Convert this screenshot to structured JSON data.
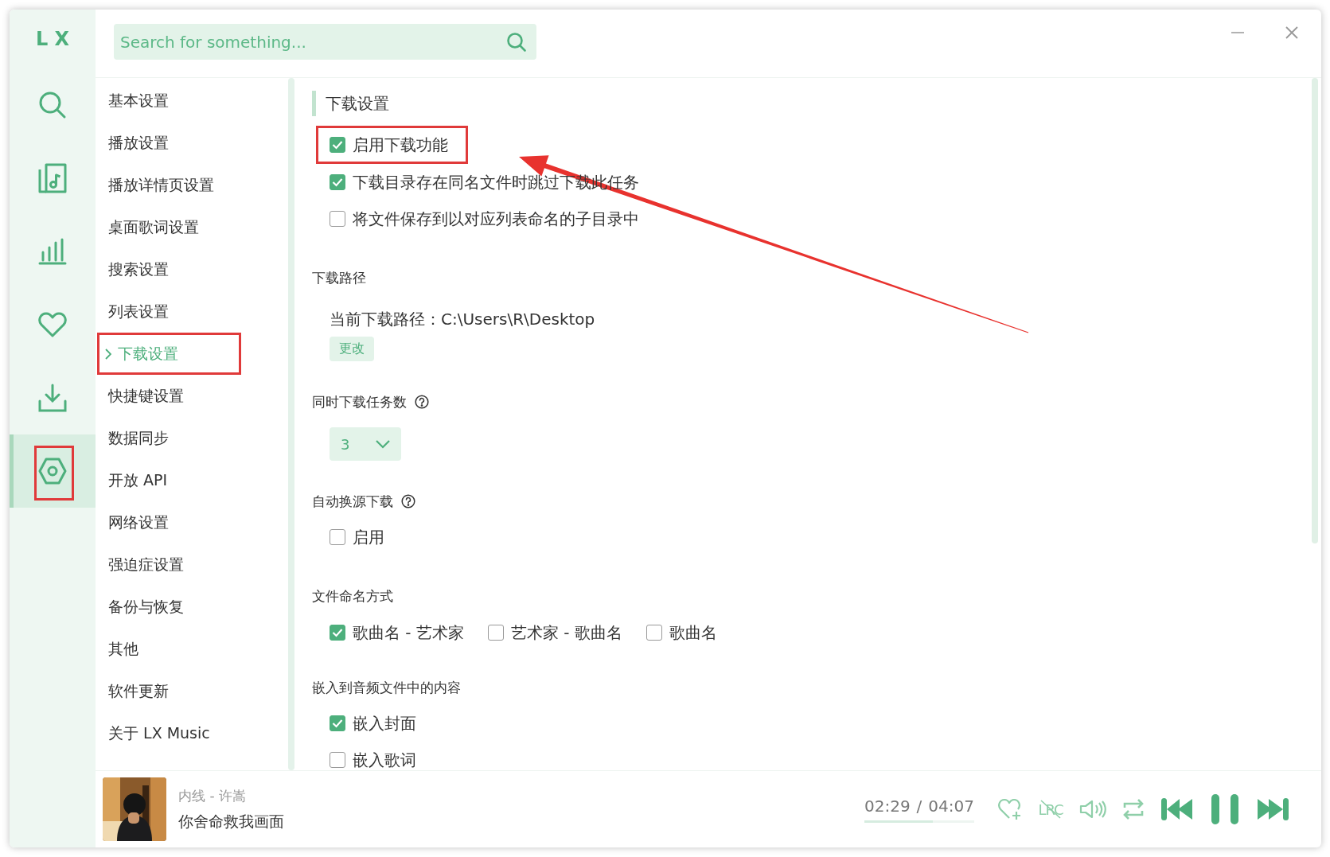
{
  "logo": "L X",
  "rail": [
    {
      "selected": false,
      "annotated": false
    },
    {
      "selected": false,
      "annotated": false
    },
    {
      "selected": false,
      "annotated": false
    },
    {
      "selected": false,
      "annotated": false
    },
    {
      "selected": false,
      "annotated": false
    },
    {
      "selected": true,
      "annotated": true
    }
  ],
  "search": {
    "placeholder": "Search for something..."
  },
  "settings_nav": [
    {
      "label": "基本设置",
      "selected": false,
      "annotated": false
    },
    {
      "label": "播放设置",
      "selected": false,
      "annotated": false
    },
    {
      "label": "播放详情页设置",
      "selected": false,
      "annotated": false
    },
    {
      "label": "桌面歌词设置",
      "selected": false,
      "annotated": false
    },
    {
      "label": "搜索设置",
      "selected": false,
      "annotated": false
    },
    {
      "label": "列表设置",
      "selected": false,
      "annotated": false
    },
    {
      "label": "下载设置",
      "selected": true,
      "annotated": true
    },
    {
      "label": "快捷键设置",
      "selected": false,
      "annotated": false
    },
    {
      "label": "数据同步",
      "selected": false,
      "annotated": false
    },
    {
      "label": "开放 API",
      "selected": false,
      "annotated": false
    },
    {
      "label": "网络设置",
      "selected": false,
      "annotated": false
    },
    {
      "label": "强迫症设置",
      "selected": false,
      "annotated": false
    },
    {
      "label": "备份与恢复",
      "selected": false,
      "annotated": false
    },
    {
      "label": "其他",
      "selected": false,
      "annotated": false
    },
    {
      "label": "软件更新",
      "selected": false,
      "annotated": false
    },
    {
      "label": "关于 LX Music",
      "selected": false,
      "annotated": false
    }
  ],
  "section_title": "下载设置",
  "sections": [
    {
      "kind": "checks",
      "inline": false,
      "options": [
        {
          "label": "启用下载功能",
          "checked": true,
          "annotated": true
        },
        {
          "label": "下载目录存在同名文件时跳过下载此任务",
          "checked": true,
          "annotated": false
        },
        {
          "label": "将文件保存到以对应列表命名的子目录中",
          "checked": false,
          "annotated": false
        }
      ]
    },
    {
      "kind": "path",
      "title": "下载路径",
      "help": false,
      "path_text": "当前下载路径：C:\\Users\\R\\Desktop",
      "button": "更改"
    },
    {
      "kind": "select",
      "title": "同时下载任务数",
      "help": true,
      "value": "3"
    },
    {
      "kind": "checks",
      "title": "自动换源下载",
      "help": true,
      "inline": false,
      "options": [
        {
          "label": "启用",
          "checked": false,
          "annotated": false
        }
      ]
    },
    {
      "kind": "checks",
      "title": "文件命名方式",
      "help": false,
      "inline": true,
      "options": [
        {
          "label": "歌曲名 - 艺术家",
          "checked": true,
          "annotated": false
        },
        {
          "label": "艺术家 - 歌曲名",
          "checked": false,
          "annotated": false
        },
        {
          "label": "歌曲名",
          "checked": false,
          "annotated": false
        }
      ]
    },
    {
      "kind": "checks",
      "title": "嵌入到音频文件中的内容",
      "help": false,
      "inline": false,
      "options": [
        {
          "label": "嵌入封面",
          "checked": true,
          "annotated": false
        },
        {
          "label": "嵌入歌词",
          "checked": false,
          "annotated": false
        }
      ]
    }
  ],
  "player": {
    "song": "内线 - 许嵩",
    "lyric": "你舍命救我画面",
    "time": "02:29",
    "separator": "/",
    "duration": "04:07",
    "level": 0.62,
    "lyrics_toggle": {
      "label": "LRC",
      "on": false
    }
  }
}
